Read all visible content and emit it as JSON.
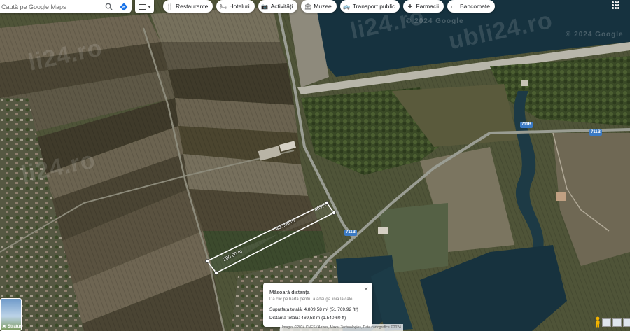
{
  "search": {
    "placeholder": "Caută pe Google Maps"
  },
  "categories": [
    {
      "icon": "fork-knife-icon",
      "glyph": "🍴",
      "label": "Restaurante"
    },
    {
      "icon": "bed-icon",
      "glyph": "🛏",
      "label": "Hoteluri"
    },
    {
      "icon": "camera-icon",
      "glyph": "📷",
      "label": "Activități"
    },
    {
      "icon": "museum-icon",
      "glyph": "🏛",
      "label": "Muzee"
    },
    {
      "icon": "bus-icon",
      "glyph": "🚌",
      "label": "Transport public"
    },
    {
      "icon": "pharmacy-icon",
      "glyph": "✚",
      "label": "Farmacii"
    },
    {
      "icon": "atm-icon",
      "glyph": "▭",
      "label": "Bancomate"
    }
  ],
  "watermarks": {
    "brand_1": "li24.ro",
    "brand_2": "li24.ro",
    "brand_3": "ubli24.ro",
    "brand_4": "li24.ro",
    "google_1": "© 2024 Google",
    "google_2": "© 2024 Google"
  },
  "roads": {
    "r1": "711B",
    "r2": "711B",
    "r3": "711B"
  },
  "measurement": {
    "segment_short_top": "469,5",
    "segment_long": "400,00 m",
    "segment_short_bottom": "200,00 m"
  },
  "infocard": {
    "title": "Măsoară distanța",
    "hint": "Dă clic pe hartă pentru a adăuga linia la cale",
    "area": "Suprafața totală: 4.809,58 m² (51.769,92 ft²)",
    "distance": "Distanța totală: 469,58 m (1.540,60 ft)",
    "close": "×"
  },
  "layers": {
    "label": "Straturi"
  },
  "attribution": "Imagini ©2024 CNES / Airbus, Maxar Technologies, Date cartografice ©2024",
  "colors": {
    "water": "#16323f",
    "field_dark": "#3f3a2a",
    "field_light": "#6b6350",
    "vegetation": "#3d4f2a",
    "road": "#9a9d93",
    "measure_line": "#ffffff",
    "shield": "#3b7ac4"
  }
}
